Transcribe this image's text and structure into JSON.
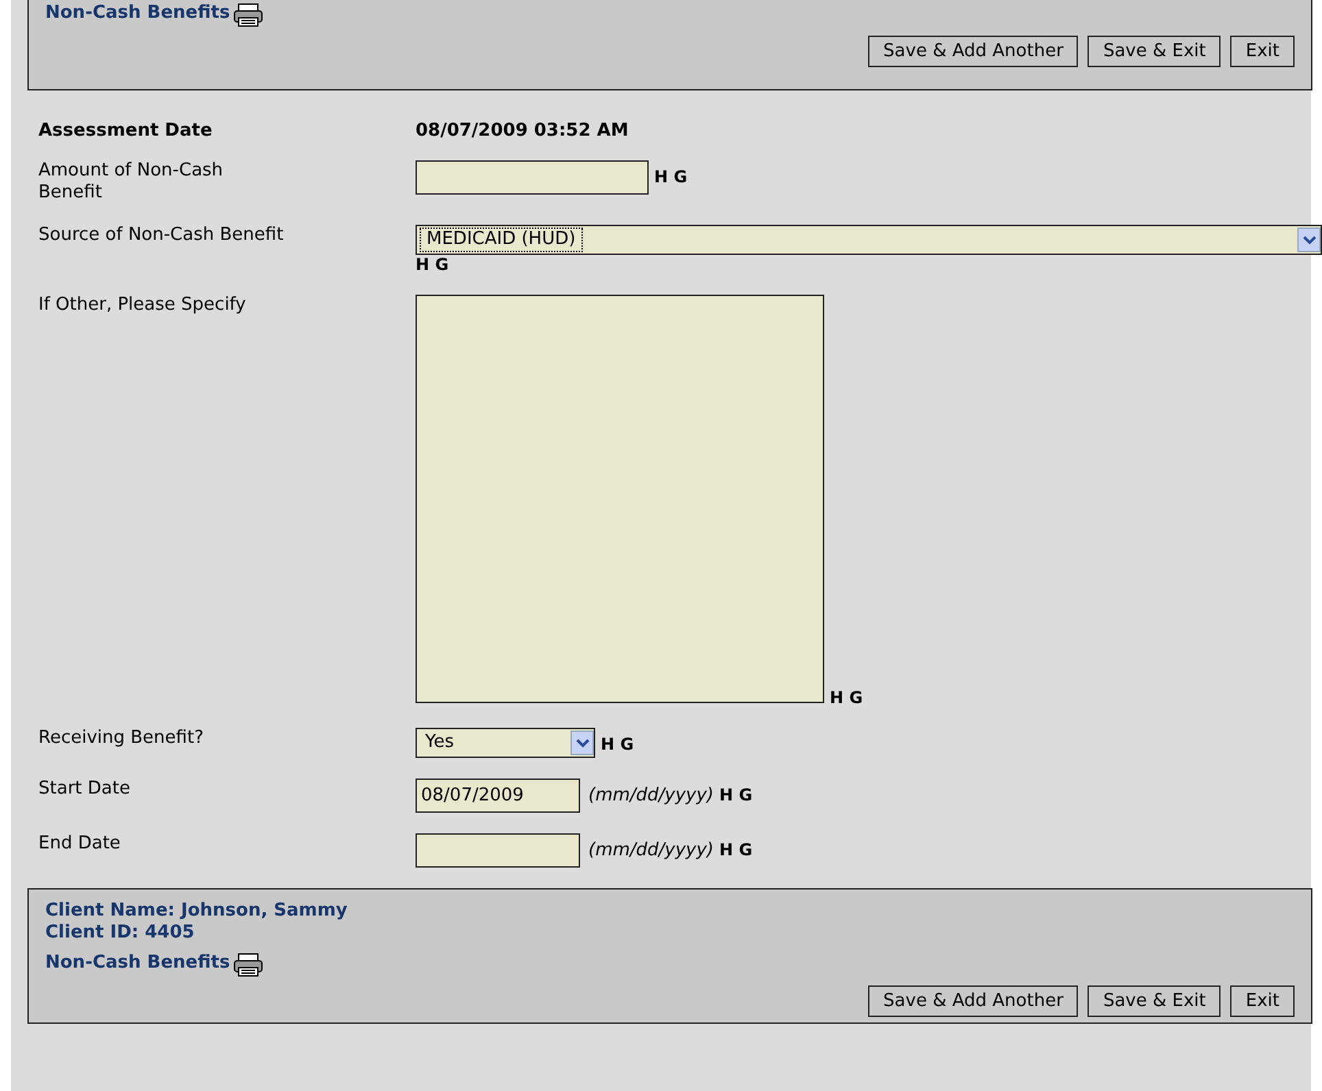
{
  "top_panel": {
    "title": "Non-Cash Benefits",
    "buttons": [
      "Save & Add Another",
      "Save & Exit",
      "Exit"
    ]
  },
  "assessment_date": {
    "label": "Assessment Date",
    "value": "08/07/2009 03:52 AM"
  },
  "fields": [
    {
      "kind": "text",
      "label": "Amount of Non-Cash Benefit",
      "flags": "H G"
    },
    {
      "kind": "wide_select",
      "label": "Source of Non-Cash Benefit",
      "value": "MEDICAID (HUD)",
      "flags": "H G"
    },
    {
      "kind": "textarea",
      "label": "If Other, Please Specify",
      "flags": "H G"
    },
    {
      "kind": "select",
      "label": "Receiving Benefit?",
      "value": "Yes",
      "flags": "H G"
    },
    {
      "kind": "date",
      "label": "Start Date",
      "value": "08/07/2009",
      "hint": "(mm/dd/yyyy)",
      "flags": "H G"
    },
    {
      "kind": "date",
      "label": "End Date",
      "hint": "(mm/dd/yyyy)",
      "flags": "H G"
    }
  ],
  "bottom_panel": {
    "client_name": "Client Name: Johnson, Sammy",
    "client_id": "Client ID: 4405",
    "title": "Non-Cash Benefits",
    "buttons": [
      "Save & Add Another",
      "Save & Exit",
      "Exit"
    ]
  }
}
